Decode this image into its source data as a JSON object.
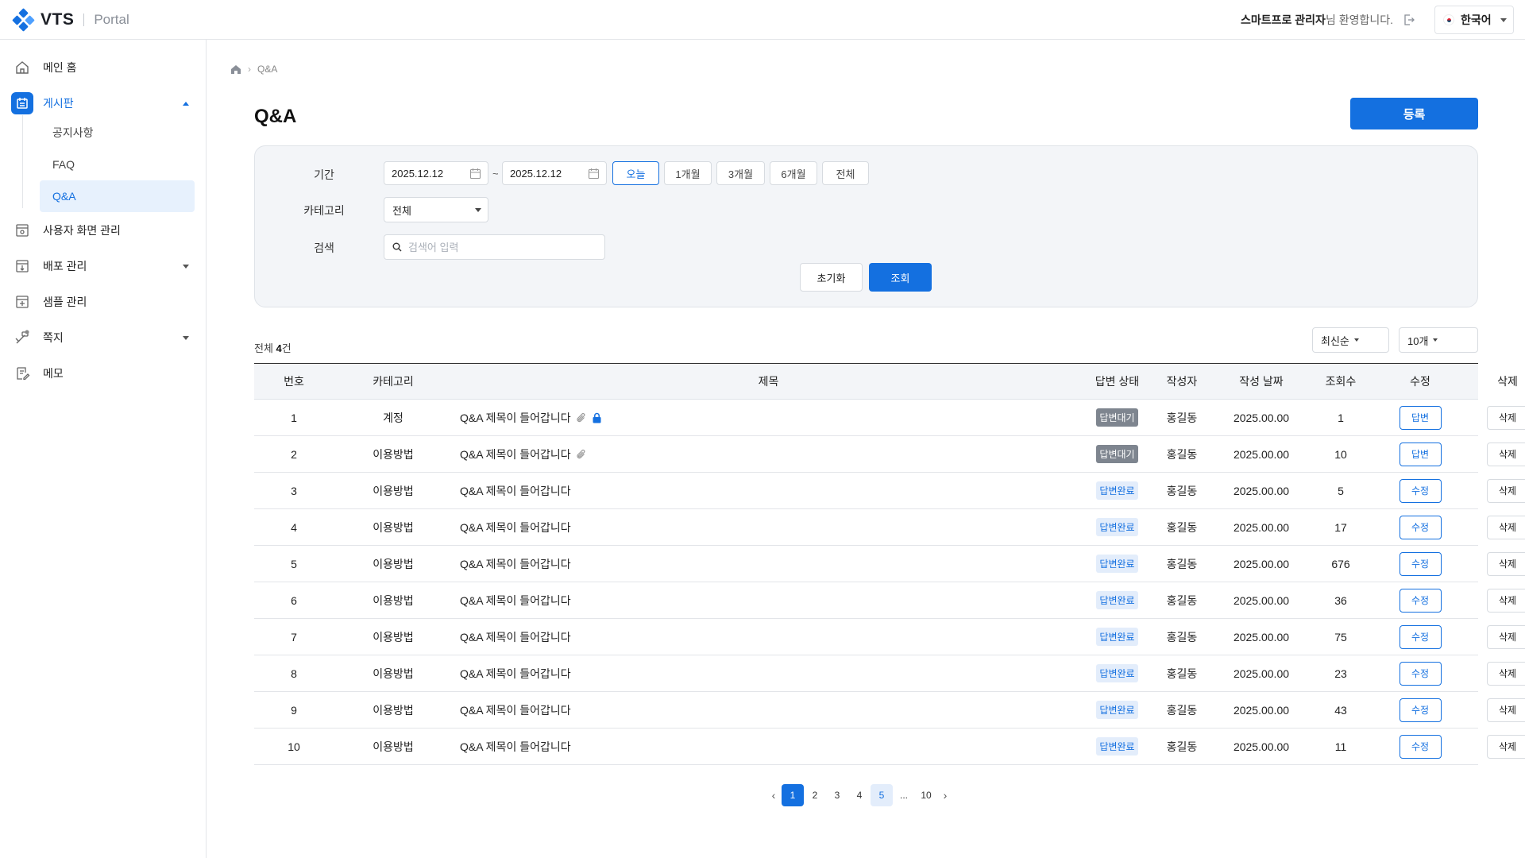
{
  "header": {
    "brand": "VTS",
    "product": "Portal",
    "welcome_name": "스마트프로 관리자",
    "welcome_suffix": "님 환영합니다.",
    "language": "한국어"
  },
  "sidebar": {
    "items": [
      {
        "label": "메인 홈",
        "icon": "home-icon"
      },
      {
        "label": "게시판",
        "icon": "board-icon",
        "expanded": true
      },
      {
        "label": "사용자 화면 관리",
        "icon": "screen-settings-icon"
      },
      {
        "label": "배포 관리",
        "icon": "deploy-icon"
      },
      {
        "label": "샘플 관리",
        "icon": "sample-icon"
      },
      {
        "label": "쪽지",
        "icon": "message-icon"
      },
      {
        "label": "메모",
        "icon": "memo-icon"
      }
    ],
    "board_sub": [
      "공지사항",
      "FAQ",
      "Q&A"
    ]
  },
  "breadcrumb": {
    "current": "Q&A"
  },
  "page": {
    "title": "Q&A",
    "register_label": "등록"
  },
  "filter": {
    "period_label": "기간",
    "date_from": "2025.12.12",
    "date_to": "2025.12.12",
    "tilde": "~",
    "ranges": [
      "오늘",
      "1개월",
      "3개월",
      "6개월",
      "전체"
    ],
    "category_label": "카테고리",
    "category_value": "전체",
    "search_label": "검색",
    "search_placeholder": "검색어 입력",
    "reset_label": "초기화",
    "query_label": "조회"
  },
  "list": {
    "total_prefix": "전체",
    "total_count": "4",
    "total_suffix": "건",
    "sort_value": "최신순",
    "page_size_value": "10개"
  },
  "table": {
    "headers": [
      "번호",
      "카테고리",
      "제목",
      "답변 상태",
      "작성자",
      "작성 날짜",
      "조회수",
      "수정",
      "삭제"
    ],
    "rows": [
      {
        "num": "1",
        "category": "계정",
        "title": "Q&A 제목이 들어갑니다",
        "attach": true,
        "lock": true,
        "status": "답변대기",
        "author": "홍길동",
        "date": "2025.00.00",
        "views": "1",
        "edit": "답변",
        "del": "삭제"
      },
      {
        "num": "2",
        "category": "이용방법",
        "title": "Q&A 제목이 들어갑니다",
        "attach": true,
        "lock": false,
        "status": "답변대기",
        "author": "홍길동",
        "date": "2025.00.00",
        "views": "10",
        "edit": "답변",
        "del": "삭제"
      },
      {
        "num": "3",
        "category": "이용방법",
        "title": "Q&A 제목이 들어갑니다",
        "attach": false,
        "lock": false,
        "status": "답변완료",
        "author": "홍길동",
        "date": "2025.00.00",
        "views": "5",
        "edit": "수정",
        "del": "삭제"
      },
      {
        "num": "4",
        "category": "이용방법",
        "title": "Q&A 제목이 들어갑니다",
        "attach": false,
        "lock": false,
        "status": "답변완료",
        "author": "홍길동",
        "date": "2025.00.00",
        "views": "17",
        "edit": "수정",
        "del": "삭제"
      },
      {
        "num": "5",
        "category": "이용방법",
        "title": "Q&A 제목이 들어갑니다",
        "attach": false,
        "lock": false,
        "status": "답변완료",
        "author": "홍길동",
        "date": "2025.00.00",
        "views": "676",
        "edit": "수정",
        "del": "삭제"
      },
      {
        "num": "6",
        "category": "이용방법",
        "title": "Q&A 제목이 들어갑니다",
        "attach": false,
        "lock": false,
        "status": "답변완료",
        "author": "홍길동",
        "date": "2025.00.00",
        "views": "36",
        "edit": "수정",
        "del": "삭제"
      },
      {
        "num": "7",
        "category": "이용방법",
        "title": "Q&A 제목이 들어갑니다",
        "attach": false,
        "lock": false,
        "status": "답변완료",
        "author": "홍길동",
        "date": "2025.00.00",
        "views": "75",
        "edit": "수정",
        "del": "삭제"
      },
      {
        "num": "8",
        "category": "이용방법",
        "title": "Q&A 제목이 들어갑니다",
        "attach": false,
        "lock": false,
        "status": "답변완료",
        "author": "홍길동",
        "date": "2025.00.00",
        "views": "23",
        "edit": "수정",
        "del": "삭제"
      },
      {
        "num": "9",
        "category": "이용방법",
        "title": "Q&A 제목이 들어갑니다",
        "attach": false,
        "lock": false,
        "status": "답변완료",
        "author": "홍길동",
        "date": "2025.00.00",
        "views": "43",
        "edit": "수정",
        "del": "삭제"
      },
      {
        "num": "10",
        "category": "이용방법",
        "title": "Q&A 제목이 들어갑니다",
        "attach": false,
        "lock": false,
        "status": "답변완료",
        "author": "홍길동",
        "date": "2025.00.00",
        "views": "11",
        "edit": "수정",
        "del": "삭제"
      }
    ]
  },
  "pagination": {
    "pages": [
      "1",
      "2",
      "3",
      "4",
      "5",
      "...",
      "10"
    ],
    "current": "1",
    "hovered": "5",
    "prev": "‹",
    "next": "›"
  },
  "colors": {
    "primary": "#1470e0",
    "waiting_badge": "#7e858f",
    "done_badge_bg": "#e3edfb"
  }
}
